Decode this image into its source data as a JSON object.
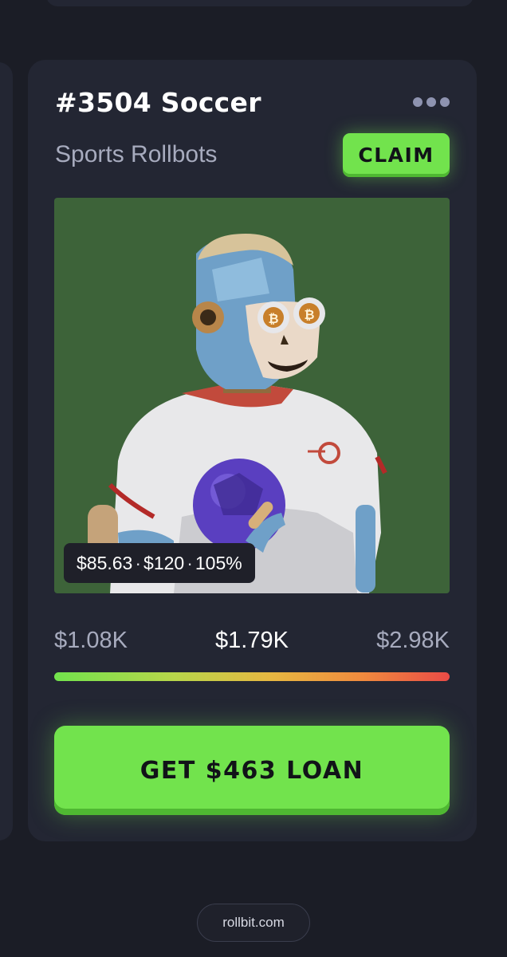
{
  "card": {
    "title": "#3504 Soccer",
    "collection": "Sports Rollbots",
    "claim_label": "CLAIM",
    "more_icon": "more-horizontal-icon"
  },
  "nft": {
    "image_description_icon": "rollbot-soccer-image",
    "background_color": "#3d6339",
    "price_parts": [
      "$85.63",
      "$120",
      "105%"
    ]
  },
  "range": {
    "low": "$1.08K",
    "mid": "$1.79K",
    "high": "$2.98K"
  },
  "loan": {
    "label": "GET $463 LOAN"
  },
  "footer": {
    "site": "rollbit.com"
  },
  "colors": {
    "accent": "#72e34d",
    "card_bg": "#232633",
    "page_bg": "#1b1d26"
  }
}
